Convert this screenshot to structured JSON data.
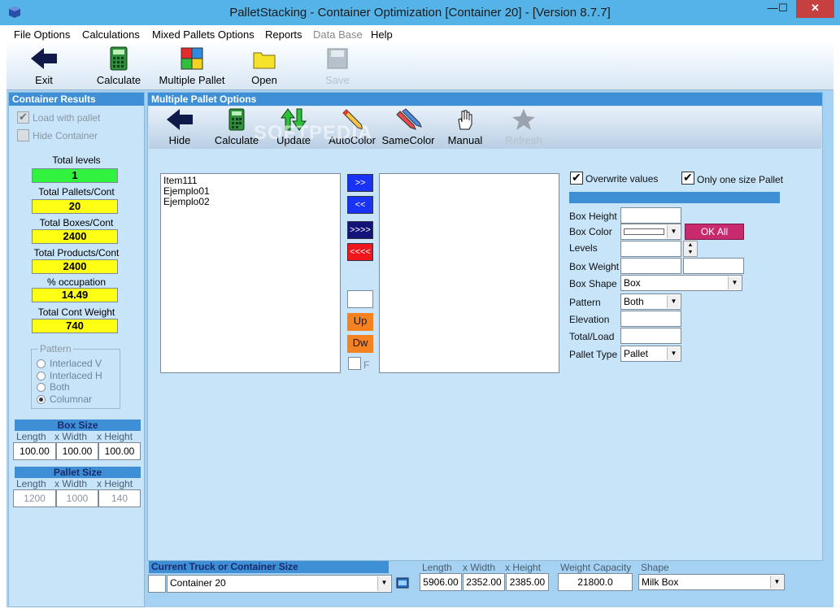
{
  "window": {
    "title": "PalletStacking - Container Optimization [Container 20] - [Version 8.7.7]",
    "minimize": "—",
    "maximize": "☐",
    "close": "✕"
  },
  "menu": {
    "items": [
      "File Options",
      "Calculations",
      "Mixed Pallets Options",
      "Reports",
      "Data Base",
      "Help"
    ],
    "disabled": [
      "Data Base"
    ]
  },
  "toolbar": {
    "exit": "Exit",
    "calculate": "Calculate",
    "multiple_pallet": "Multiple Pallet",
    "open": "Open",
    "save": "Save"
  },
  "container_results": {
    "header": "Container Results",
    "load_with_pallet": "Load with pallet",
    "hide_container": "Hide Container",
    "total_levels_label": "Total levels",
    "total_levels": "1",
    "total_pallets_label": "Total Pallets/Cont",
    "total_pallets": "20",
    "total_boxes_label": "Total Boxes/Cont",
    "total_boxes": "2400",
    "total_products_label": "Total Products/Cont",
    "total_products": "2400",
    "occupation_label": "% occupation",
    "occupation": "14.49",
    "weight_label": "Total Cont Weight",
    "weight": "740",
    "pattern": {
      "title": "Pattern",
      "options": [
        "Interlaced V",
        "Interlaced H",
        "Both",
        "Columnar"
      ],
      "selected": "Columnar"
    },
    "box_size": {
      "title": "Box Size",
      "length_label": "Length",
      "width_label": "x  Width",
      "height_label": "x  Height",
      "length": "100.00",
      "width": "100.00",
      "height": "100.00"
    },
    "pallet_size": {
      "title": "Pallet Size",
      "length_label": "Length",
      "width_label": "x  Width",
      "height_label": "x  Height",
      "length": "1200",
      "width": "1000",
      "height": "140"
    }
  },
  "multiple_pallet_options": {
    "header": "Multiple Pallet Options",
    "toolbar": {
      "hide": "Hide",
      "calculate": "Calculate",
      "update": "Update",
      "autocolor": "AutoColor",
      "samecolor": "SameColor",
      "manual": "Manual",
      "refresh": "Refresh"
    },
    "watermark": "SOFTPEDIA",
    "left_list": [
      "Item111",
      "Ejemplo01",
      "Ejemplo02"
    ],
    "buttons": {
      "move_right": ">>",
      "move_left": "<<",
      "move_all_right": ">>>>",
      "move_all_left": "<<<<",
      "up": "Up",
      "down": "Dw",
      "f_label": "F"
    },
    "overwrite_values": "Overwrite values",
    "only_one_size_pallet": "Only one size Pallet",
    "fields": {
      "box_height": "Box Height",
      "box_color": "Box Color",
      "levels": "Levels",
      "box_weight": "Box Weight",
      "box_shape": "Box Shape",
      "pattern": "Pattern",
      "elevation": "Elevation",
      "total_load": "Total/Load",
      "pallet_type": "Pallet Type"
    },
    "ok_all": "OK All",
    "box_shape_value": "Box",
    "pattern_value": "Both",
    "pallet_type_value": "Pallet"
  },
  "truck": {
    "header": "Current Truck or Container Size",
    "container": "Container 20",
    "length_label": "Length",
    "width_label": "x  Width",
    "height_label": "x  Height",
    "length": "5906.00",
    "width": "2352.00",
    "height": "2385.00",
    "capacity_label": "Weight Capacity",
    "capacity": "21800.0",
    "shape_label": "Shape",
    "shape": "Milk Box"
  }
}
